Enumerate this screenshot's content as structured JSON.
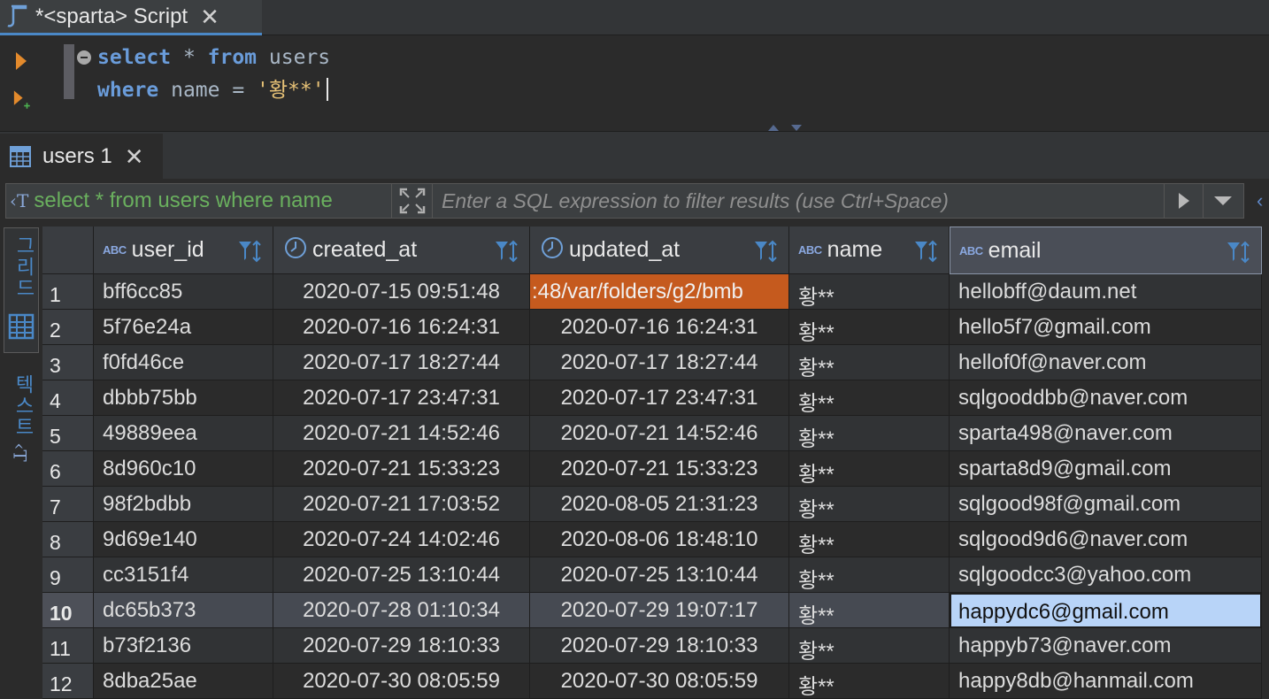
{
  "editor_tab": {
    "title": "*<sparta> Script"
  },
  "sql": {
    "line1": {
      "kw1": "select",
      "sym": " * ",
      "kw2": "from",
      "rest": " users"
    },
    "line2": {
      "kw": "where",
      "mid": " name = ",
      "str": "'황**'"
    }
  },
  "results_tab": {
    "title": "users 1"
  },
  "filter": {
    "query_text": "select * from users where name",
    "placeholder": "Enter a SQL expression to filter results (use Ctrl+Space)"
  },
  "side_panel": {
    "grid_label": "그리드",
    "text_label": "텍스트"
  },
  "grid": {
    "columns": [
      {
        "type": "ABC",
        "name": "user_id"
      },
      {
        "type": "clock",
        "name": "created_at"
      },
      {
        "type": "clock",
        "name": "updated_at"
      },
      {
        "type": "ABC",
        "name": "name"
      },
      {
        "type": "ABC",
        "name": "email"
      }
    ],
    "rows": [
      {
        "n": "1",
        "user_id": "bff6cc85",
        "created_at": "2020-07-15 09:51:48",
        "updated_at": ":48/var/folders/g2/bmb",
        "name": "황**",
        "email": "hellobff@daum.net"
      },
      {
        "n": "2",
        "user_id": "5f76e24a",
        "created_at": "2020-07-16 16:24:31",
        "updated_at": "2020-07-16 16:24:31",
        "name": "황**",
        "email": "hello5f7@gmail.com"
      },
      {
        "n": "3",
        "user_id": "f0fd46ce",
        "created_at": "2020-07-17 18:27:44",
        "updated_at": "2020-07-17 18:27:44",
        "name": "황**",
        "email": "hellof0f@naver.com"
      },
      {
        "n": "4",
        "user_id": "dbbb75bb",
        "created_at": "2020-07-17 23:47:31",
        "updated_at": "2020-07-17 23:47:31",
        "name": "황**",
        "email": "sqlgooddbb@naver.com"
      },
      {
        "n": "5",
        "user_id": "49889eea",
        "created_at": "2020-07-21 14:52:46",
        "updated_at": "2020-07-21 14:52:46",
        "name": "황**",
        "email": "sparta498@naver.com"
      },
      {
        "n": "6",
        "user_id": "8d960c10",
        "created_at": "2020-07-21 15:33:23",
        "updated_at": "2020-07-21 15:33:23",
        "name": "황**",
        "email": "sparta8d9@gmail.com"
      },
      {
        "n": "7",
        "user_id": "98f2bdbb",
        "created_at": "2020-07-21 17:03:52",
        "updated_at": "2020-08-05 21:31:23",
        "name": "황**",
        "email": "sqlgood98f@gmail.com"
      },
      {
        "n": "8",
        "user_id": "9d69e140",
        "created_at": "2020-07-24 14:02:46",
        "updated_at": "2020-08-06 18:48:10",
        "name": "황**",
        "email": "sqlgood9d6@naver.com"
      },
      {
        "n": "9",
        "user_id": "cc3151f4",
        "created_at": "2020-07-25 13:10:44",
        "updated_at": "2020-07-25 13:10:44",
        "name": "황**",
        "email": "sqlgoodcc3@yahoo.com"
      },
      {
        "n": "10",
        "user_id": "dc65b373",
        "created_at": "2020-07-28 01:10:34",
        "updated_at": "2020-07-29 19:07:17",
        "name": "황**",
        "email": "happydc6@gmail.com"
      },
      {
        "n": "11",
        "user_id": "b73f2136",
        "created_at": "2020-07-29 18:10:33",
        "updated_at": "2020-07-29 18:10:33",
        "name": "황**",
        "email": "happyb73@naver.com"
      },
      {
        "n": "12",
        "user_id": "8dba25ae",
        "created_at": "2020-07-30 08:05:59",
        "updated_at": "2020-07-30 08:05:59",
        "name": "황**",
        "email": "happy8db@hanmail.com"
      }
    ]
  },
  "colors": {
    "accent": "#4a88c7",
    "error_cell": "#c55a1e",
    "focus_cell": "#b8d4f8",
    "keyword": "#6a9cda",
    "string": "#e6c176",
    "query_text": "#6ab05e"
  }
}
